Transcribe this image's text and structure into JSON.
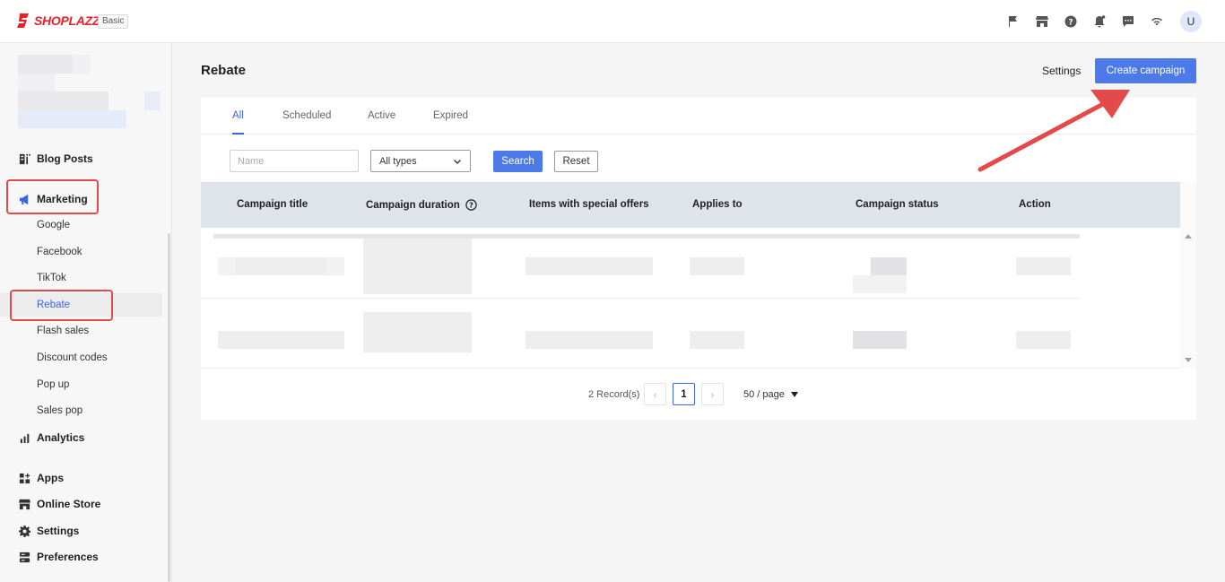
{
  "app": {
    "brand": "SHOPLAZZA",
    "plan": "Basic",
    "user_initial": "U"
  },
  "sidebar": {
    "main_items": [
      {
        "label": "Blog Posts",
        "icon": "blog-icon"
      },
      {
        "label": "Marketing",
        "icon": "megaphone-icon"
      },
      {
        "label": "Analytics",
        "icon": "bar-chart-icon"
      },
      {
        "label": "Apps",
        "icon": "apps-icon"
      },
      {
        "label": "Online Store",
        "icon": "store-icon"
      },
      {
        "label": "Settings",
        "icon": "gear-icon"
      },
      {
        "label": "Preferences",
        "icon": "preferences-icon"
      }
    ],
    "marketing_items": [
      {
        "label": "Google"
      },
      {
        "label": "Facebook"
      },
      {
        "label": "TikTok"
      },
      {
        "label": "Rebate",
        "active": true
      },
      {
        "label": "Flash sales"
      },
      {
        "label": "Discount codes"
      },
      {
        "label": "Pop up"
      },
      {
        "label": "Sales pop"
      }
    ]
  },
  "page": {
    "title": "Rebate",
    "settings_label": "Settings",
    "create_label": "Create campaign",
    "tabs": [
      {
        "label": "All",
        "active": true
      },
      {
        "label": "Scheduled"
      },
      {
        "label": "Active"
      },
      {
        "label": "Expired"
      }
    ],
    "filters": {
      "name_placeholder": "Name",
      "type_value": "All types",
      "search_label": "Search",
      "reset_label": "Reset"
    },
    "table": {
      "columns": [
        "Campaign title",
        "Campaign duration",
        "Items with special offers",
        "Applies to",
        "Campaign status",
        "Action"
      ]
    },
    "pagination": {
      "records": "2 Record(s)",
      "current_page": "1",
      "page_size": "50 / page"
    }
  },
  "colors": {
    "accent": "#4c7ae8",
    "brand_red": "#e8202a",
    "annotation_red": "#e34a4a"
  }
}
